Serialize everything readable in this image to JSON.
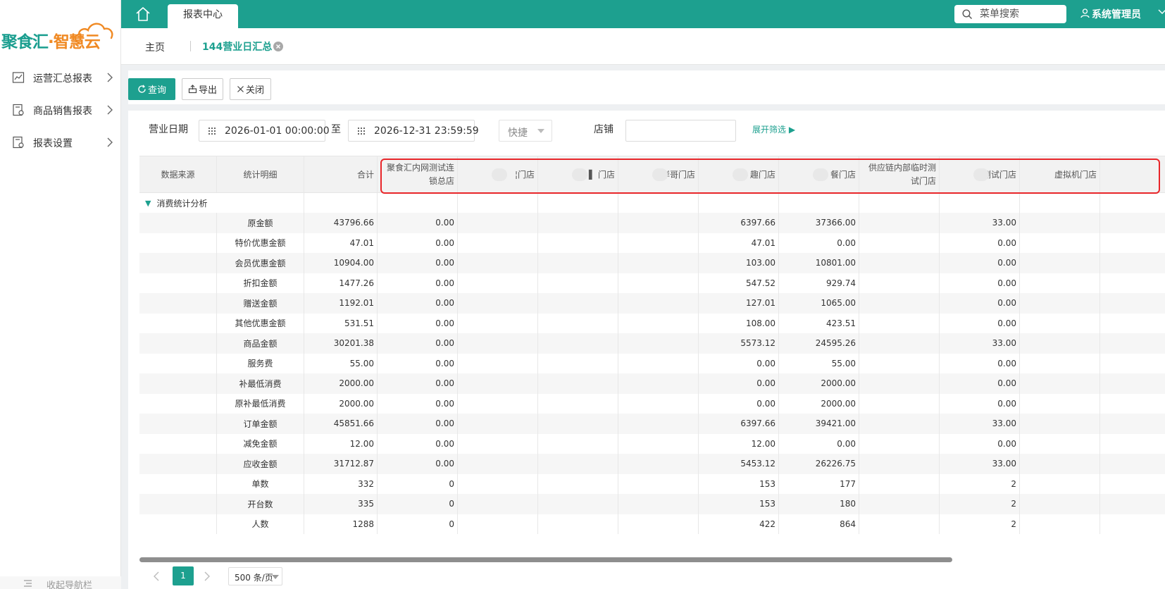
{
  "brand": {
    "name_part1": "聚食汇",
    "name_part2": "·智慧云"
  },
  "sidebar": {
    "items": [
      {
        "label": "运营汇总报表",
        "icon": "line-chart-icon"
      },
      {
        "label": "商品销售报表",
        "icon": "product-report-icon"
      },
      {
        "label": "报表设置",
        "icon": "report-settings-icon"
      }
    ],
    "collapse_label": "收起导航栏"
  },
  "topbar": {
    "tab_label": "报表中心",
    "search_placeholder": "菜单搜索",
    "user_label": "系统管理员"
  },
  "breadcrumb": {
    "home": "主页",
    "active": "144营业日汇总"
  },
  "toolbar": {
    "query_label": "查询",
    "export_label": "导出",
    "close_label": "关闭"
  },
  "filter": {
    "date_label": "营业日期",
    "start_value": "2026-01-01 00:00:00",
    "to_label": "至",
    "end_value": "2026-12-31 23:59:59",
    "quick_label": "快捷",
    "store_label": "店铺",
    "expand_label": "展开筛选 ▶"
  },
  "table": {
    "columns": [
      "数据来源",
      "统计明细",
      "合计",
      "聚食汇内网测试连锁总店",
      "¦门店",
      "▌ 门店",
      "岸哥门店",
      "趣门店",
      "餐门店",
      "供应链内部临时测试门店",
      "测试门店",
      "虚拟机门店"
    ],
    "group_label": "消费统计分析",
    "rows": [
      [
        "",
        "原金额",
        "43796.66",
        "0.00",
        "",
        "",
        "",
        "6397.66",
        "37366.00",
        "",
        "33.00",
        ""
      ],
      [
        "",
        "特价优惠金额",
        "47.01",
        "0.00",
        "",
        "",
        "",
        "47.01",
        "0.00",
        "",
        "0.00",
        ""
      ],
      [
        "",
        "会员优惠金额",
        "10904.00",
        "0.00",
        "",
        "",
        "",
        "103.00",
        "10801.00",
        "",
        "0.00",
        ""
      ],
      [
        "",
        "折扣金额",
        "1477.26",
        "0.00",
        "",
        "",
        "",
        "547.52",
        "929.74",
        "",
        "0.00",
        ""
      ],
      [
        "",
        "赠送金额",
        "1192.01",
        "0.00",
        "",
        "",
        "",
        "127.01",
        "1065.00",
        "",
        "0.00",
        ""
      ],
      [
        "",
        "其他优惠金额",
        "531.51",
        "0.00",
        "",
        "",
        "",
        "108.00",
        "423.51",
        "",
        "0.00",
        ""
      ],
      [
        "",
        "商品金额",
        "30201.38",
        "0.00",
        "",
        "",
        "",
        "5573.12",
        "24595.26",
        "",
        "33.00",
        ""
      ],
      [
        "",
        "服务费",
        "55.00",
        "0.00",
        "",
        "",
        "",
        "0.00",
        "55.00",
        "",
        "0.00",
        ""
      ],
      [
        "",
        "补最低消费",
        "2000.00",
        "0.00",
        "",
        "",
        "",
        "0.00",
        "2000.00",
        "",
        "0.00",
        ""
      ],
      [
        "",
        "原补最低消费",
        "2000.00",
        "0.00",
        "",
        "",
        "",
        "0.00",
        "2000.00",
        "",
        "0.00",
        ""
      ],
      [
        "",
        "订单金额",
        "45851.66",
        "0.00",
        "",
        "",
        "",
        "6397.66",
        "39421.00",
        "",
        "33.00",
        ""
      ],
      [
        "",
        "减免金额",
        "12.00",
        "0.00",
        "",
        "",
        "",
        "12.00",
        "0.00",
        "",
        "0.00",
        ""
      ],
      [
        "",
        "应收金额",
        "31712.87",
        "0.00",
        "",
        "",
        "",
        "5453.12",
        "26226.75",
        "",
        "33.00",
        ""
      ],
      [
        "",
        "单数",
        "332",
        "0",
        "",
        "",
        "",
        "153",
        "177",
        "",
        "2",
        ""
      ],
      [
        "",
        "开台数",
        "335",
        "0",
        "",
        "",
        "",
        "153",
        "180",
        "",
        "2",
        ""
      ],
      [
        "",
        "人数",
        "1288",
        "0",
        "",
        "",
        "",
        "422",
        "864",
        "",
        "2",
        ""
      ]
    ]
  },
  "pager": {
    "current": "1",
    "page_size": "500 条/页"
  },
  "colors": {
    "accent": "#1da08f",
    "highlight": "#e8262a",
    "logo_orange": "#f08a24"
  }
}
